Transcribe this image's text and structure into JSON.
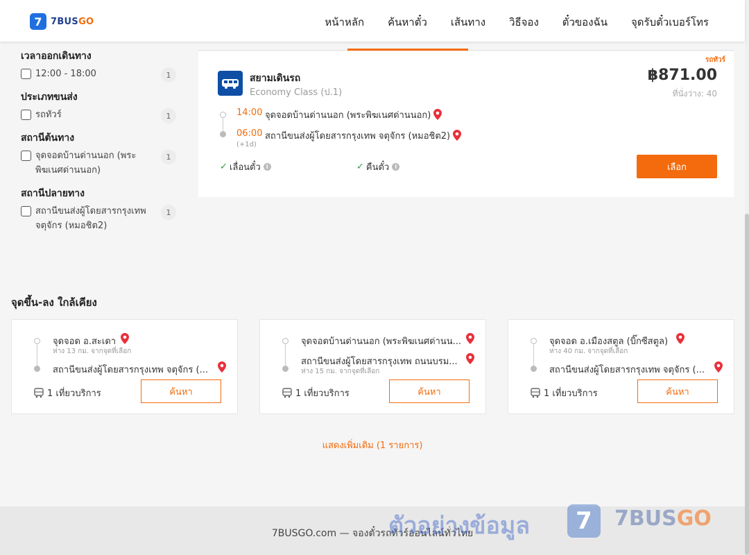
{
  "header": {
    "logo_mark": "7",
    "logo_brand": "7BUS",
    "logo_brand_accent": "GO",
    "nav": [
      "หน้าหลัก",
      "ค้นหาตั๋ว",
      "เส้นทาง",
      "วิธีจอง",
      "ตั๋วของฉัน",
      "จุดรับตั๋วเบอร์โทร"
    ]
  },
  "filters": [
    {
      "title": "เวลาออกเดินทาง",
      "option": "12:00 - 18:00",
      "count": "1"
    },
    {
      "title": "ประเภทขนส่ง",
      "option": "รถทัวร์",
      "count": "1"
    },
    {
      "title": "สถานีต้นทาง",
      "option": "จุดจอดบ้านด่านนอก (พระพิฆเนศด่านนอก)",
      "count": "1"
    },
    {
      "title": "สถานีปลายทาง",
      "option": "สถานีขนส่งผู้โดยสารกรุงเทพ จตุจักร (หมอชิต2)",
      "count": "1"
    }
  ],
  "trip": {
    "type_tag": "รถทัวร์",
    "operator": "สยามเดินรถ",
    "class": "Economy Class (ป.1)",
    "price": "฿871.00",
    "seats": "ที่นั่งว่าง: 40",
    "depart_time": "14:00",
    "depart_stop": "จุดจอดบ้านด่านนอก (พระพิฆเนศด่านนอก)",
    "arrive_time": "06:00",
    "arrive_stop": "สถานีขนส่งผู้โดยสารกรุงเทพ จตุจักร (หมอชิต2)",
    "plus_day": "(+1d)",
    "feature_1": "เลื่อนตั๋ว",
    "feature_2": "คืนตั๋ว",
    "select_label": "เลือก"
  },
  "nearby": {
    "title": "จุดขึ้น-ลง ใกล้เคียง",
    "cards": [
      {
        "from": "จุดจอด อ.สะเดา",
        "from_dist": "ห่าง 13 กม. จากจุดที่เลือก",
        "to": "สถานีขนส่งผู้โดยสารกรุงเทพ จตุจักร (...",
        "to_dist": "",
        "service": "1 เที่ยวบริการ",
        "button": "ค้นหา"
      },
      {
        "from": "จุดจอดบ้านด่านนอก (พระพิฆเนศด่านน...",
        "from_dist": "",
        "to": "สถานีขนส่งผู้โดยสารกรุงเทพ ถนนบรม...",
        "to_dist": "ห่าง 15 กม. จากจุดที่เลือก",
        "service": "1 เที่ยวบริการ",
        "button": "ค้นหา"
      },
      {
        "from": "จุดจอด อ.เมืองสตูล (บิ๊กซีสตูล)",
        "from_dist": "ห่าง 40 กม. จากจุดที่เลือก",
        "to": "สถานีขนส่งผู้โดยสารกรุงเทพ จตุจักร (...",
        "to_dist": "",
        "service": "1 เที่ยวบริการ",
        "button": "ค้นหา"
      }
    ],
    "show_more": "แสดงเพิ่มเติม (1 รายการ)"
  },
  "footer": {
    "text": "7BUSGO.com — จองตั๋วรถทัวร์ออนไลน์ทั่วไทย",
    "watermark": "ตัวอย่างข้อมูล",
    "watermark_mark": "7",
    "watermark_brand": "7BUS",
    "watermark_brand_accent": "GO"
  },
  "colors": {
    "accent": "#f36b0c",
    "brand_blue": "#1f6fe0",
    "check_green": "#2a9d3c",
    "pin_red": "#e8303a"
  }
}
